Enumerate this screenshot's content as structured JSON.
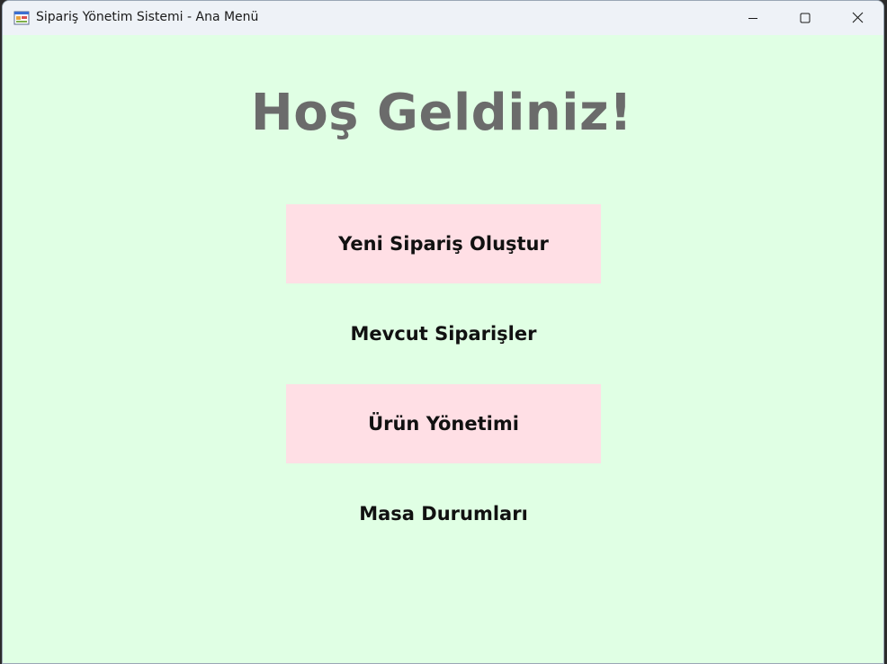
{
  "window": {
    "title": "Sipariş Yönetim Sistemi - Ana Menü",
    "icon": "app-window-icon",
    "background": "#e0ffe4",
    "titlebar_background": "#eef2f7"
  },
  "captions": {
    "minimize_icon": "minimize-icon",
    "maximize_icon": "maximize-icon",
    "close_icon": "close-icon"
  },
  "main": {
    "welcome": "Hoş Geldiniz!",
    "welcome_color": "#6b6b6b",
    "buttons": [
      {
        "label": "Yeni Sipariş Oluştur",
        "background": "#ffdfe5"
      },
      {
        "label": "Mevcut Siparişler",
        "background": "transparent"
      },
      {
        "label": "Ürün Yönetimi",
        "background": "#ffdfe5"
      },
      {
        "label": "Masa Durumları",
        "background": "transparent"
      }
    ]
  }
}
